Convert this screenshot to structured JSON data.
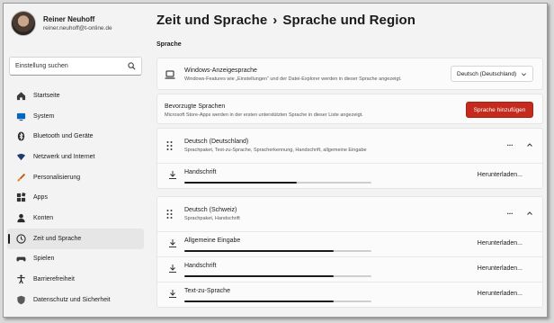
{
  "profile": {
    "name": "Reiner Neuhoff",
    "email": "reiner.neuhoff@t-online.de"
  },
  "search": {
    "placeholder": "Einstellung suchen",
    "icon": "search-icon"
  },
  "sidebar": {
    "items": [
      {
        "label": "Startseite",
        "icon": "home-icon",
        "active": false
      },
      {
        "label": "System",
        "icon": "monitor-icon",
        "active": false
      },
      {
        "label": "Bluetooth und Geräte",
        "icon": "bluetooth-icon",
        "active": false
      },
      {
        "label": "Netzwerk und Internet",
        "icon": "wifi-icon",
        "active": false
      },
      {
        "label": "Personalisierung",
        "icon": "brush-icon",
        "active": false
      },
      {
        "label": "Apps",
        "icon": "apps-icon",
        "active": false
      },
      {
        "label": "Konten",
        "icon": "person-icon",
        "active": false
      },
      {
        "label": "Zeit und Sprache",
        "icon": "globe-clock-icon",
        "active": true
      },
      {
        "label": "Spielen",
        "icon": "gamepad-icon",
        "active": false
      },
      {
        "label": "Barrierefreiheit",
        "icon": "accessibility-icon",
        "active": false
      },
      {
        "label": "Datenschutz und Sicherheit",
        "icon": "shield-icon",
        "active": false
      }
    ]
  },
  "header": {
    "breadcrumb_parent": "Zeit und Sprache",
    "separator": "›",
    "breadcrumb_current": "Sprache und Region"
  },
  "section": {
    "label": "Sprache"
  },
  "display_language": {
    "title": "Windows-Anzeigesprache",
    "subtitle": "Windows-Features wie „Einstellungen“ und der Datei-Explorer werden in dieser Sprache angezeigt.",
    "selected": "Deutsch (Deutschland)"
  },
  "preferred": {
    "title": "Bevorzugte Sprachen",
    "subtitle": "Microsoft Store-Apps werden in der ersten unterstützten Sprache in dieser Liste angezeigt.",
    "add_button": "Sprache hinzufügen"
  },
  "languages": [
    {
      "name": "Deutsch (Deutschland)",
      "features": "Sprachpaket, Text-zu-Sprache, Spracherkennung, Handschrift, allgemeine Eingabe",
      "more": "...",
      "downloads": [
        {
          "name": "Handschrift",
          "status": "Herunterladen...",
          "progress": 0.6
        }
      ]
    },
    {
      "name": "Deutsch (Schweiz)",
      "features": "Sprachpaket, Handschrift",
      "more": "...",
      "downloads": [
        {
          "name": "Allgemeine Eingabe",
          "status": "Herunterladen...",
          "progress": 0.8
        },
        {
          "name": "Handschrift",
          "status": "Herunterladen...",
          "progress": 0.8
        },
        {
          "name": "Text-zu-Sprache",
          "status": "Herunterladen...",
          "progress": 0.8
        }
      ]
    }
  ],
  "colors": {
    "accent": "#c42b1c",
    "text": "#1b1b1b",
    "background": "#f3f3f3",
    "card": "#fbfbfb"
  }
}
